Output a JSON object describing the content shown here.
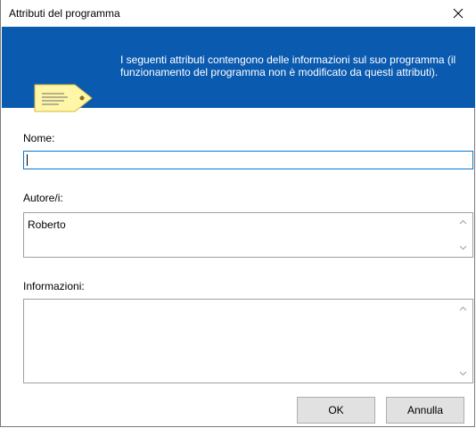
{
  "window": {
    "title": "Attributi del programma"
  },
  "banner": {
    "description": "I seguenti attributi contengono delle informazioni sul suo programma (il funzionamento del programma non è modificato da questi attributi).",
    "background_color": "#0a5bb0",
    "icon": "tag-icon"
  },
  "fields": {
    "name_label": "Nome:",
    "name_value": "",
    "authors_label": "Autore/i:",
    "authors_value": "Roberto",
    "info_label": "Informazioni:",
    "info_value": ""
  },
  "buttons": {
    "ok_label": "OK",
    "cancel_label": "Annulla"
  }
}
